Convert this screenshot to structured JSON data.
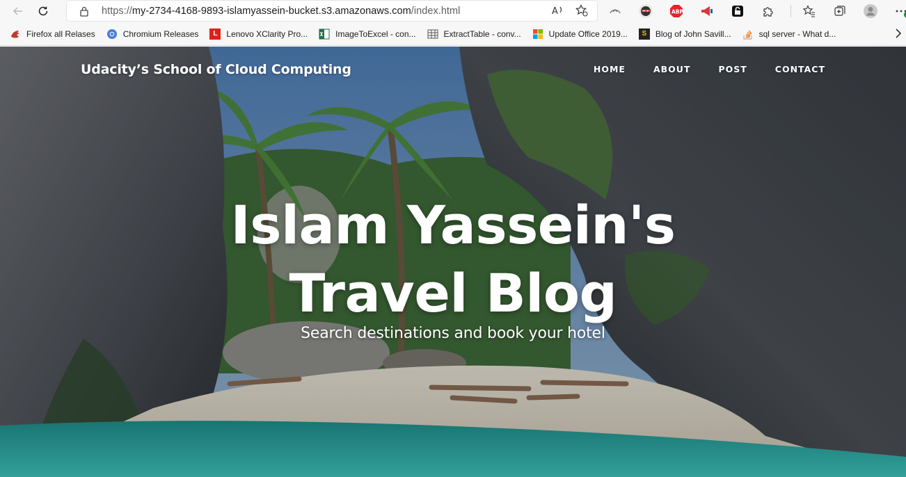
{
  "browser": {
    "url_prefix": "https://",
    "url_host": "my-2734-4168-9893-islamyassein-bucket.s3.amazonaws.com",
    "url_path": "/index.html",
    "bookmarks": [
      {
        "label": "Firefox all Relases",
        "icon": "firefox-icon",
        "color": "#c0392b"
      },
      {
        "label": "Chromium Releases",
        "icon": "chromium-icon",
        "color": "#4a7fd6"
      },
      {
        "label": "Lenovo XClarity Pro...",
        "icon": "lenovo-icon",
        "color": "#e0201b"
      },
      {
        "label": "ImageToExcel - con...",
        "icon": "excel-icon",
        "color": "#1e7145"
      },
      {
        "label": "ExtractTable - conv...",
        "icon": "table-icon",
        "color": "#555555"
      },
      {
        "label": "Update Office 2019...",
        "icon": "microsoft-icon",
        "color": "#f25022"
      },
      {
        "label": "Blog of John Savill...",
        "icon": "savill-icon",
        "color": "#222222"
      },
      {
        "label": "sql server - What d...",
        "icon": "stackoverflow-icon",
        "color": "#f48024"
      }
    ]
  },
  "site": {
    "brand": "Udacity’s School of Cloud Computing",
    "menu": [
      "HOME",
      "ABOUT",
      "POST",
      "CONTACT"
    ],
    "hero_title_line1": "Islam Yassein's",
    "hero_title_line2": "Travel Blog",
    "hero_subtitle": "Search destinations and book your hotel"
  }
}
